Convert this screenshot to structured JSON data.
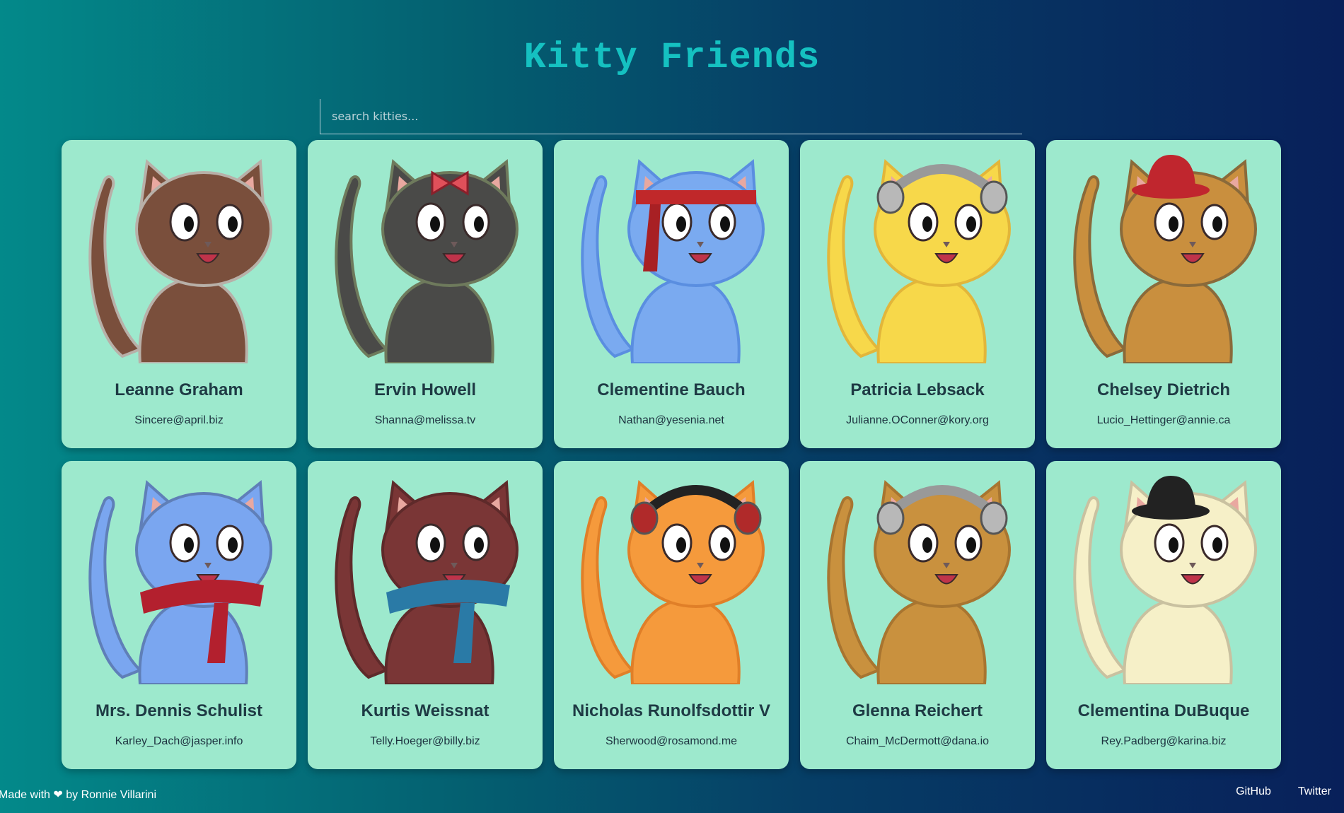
{
  "header": {
    "title": "Kitty Friends"
  },
  "search": {
    "placeholder": "search kitties..."
  },
  "cards": [
    {
      "name": "Leanne Graham",
      "email": "Sincere@april.biz",
      "fur": "#7a4f3c",
      "accent": "#b8b0a8",
      "accessory": "none"
    },
    {
      "name": "Ervin Howell",
      "email": "Shanna@melissa.tv",
      "fur": "#4a4a48",
      "accent": "#6e7a5c",
      "accessory": "bow"
    },
    {
      "name": "Clementine Bauch",
      "email": "Nathan@yesenia.net",
      "fur": "#7aaaf0",
      "accent": "#5a8ee0",
      "accessory": "headband"
    },
    {
      "name": "Patricia Lebsack",
      "email": "Julianne.OConner@kory.org",
      "fur": "#f7d84a",
      "accent": "#e2b63a",
      "accessory": "headphones-silver"
    },
    {
      "name": "Chelsey Dietrich",
      "email": "Lucio_Hettinger@annie.ca",
      "fur": "#c98f3e",
      "accent": "#8a6a3a",
      "accessory": "hat-red"
    },
    {
      "name": "Mrs. Dennis Schulist",
      "email": "Karley_Dach@jasper.info",
      "fur": "#7aa6f0",
      "accent": "#5f7fb8",
      "accessory": "scarf-red"
    },
    {
      "name": "Kurtis Weissnat",
      "email": "Telly.Hoeger@billy.biz",
      "fur": "#7a3636",
      "accent": "#5e2a2a",
      "accessory": "scarf-blue"
    },
    {
      "name": "Nicholas Runolfsdottir V",
      "email": "Sherwood@rosamond.me",
      "fur": "#f59a3c",
      "accent": "#e07f28",
      "accessory": "headphones-red"
    },
    {
      "name": "Glenna Reichert",
      "email": "Chaim_McDermott@dana.io",
      "fur": "#c9913e",
      "accent": "#a87530",
      "accessory": "headphones-silver"
    },
    {
      "name": "Clementina DuBuque",
      "email": "Rey.Padberg@karina.biz",
      "fur": "#f6f0c8",
      "accent": "#c9c1a0",
      "accessory": "hat-black"
    }
  ],
  "footer": {
    "made_with_prefix": "Made with",
    "made_with_suffix": "by Ronnie Villarini",
    "heart_icon": "heart-icon",
    "links": [
      "GitHub",
      "Twitter"
    ]
  }
}
